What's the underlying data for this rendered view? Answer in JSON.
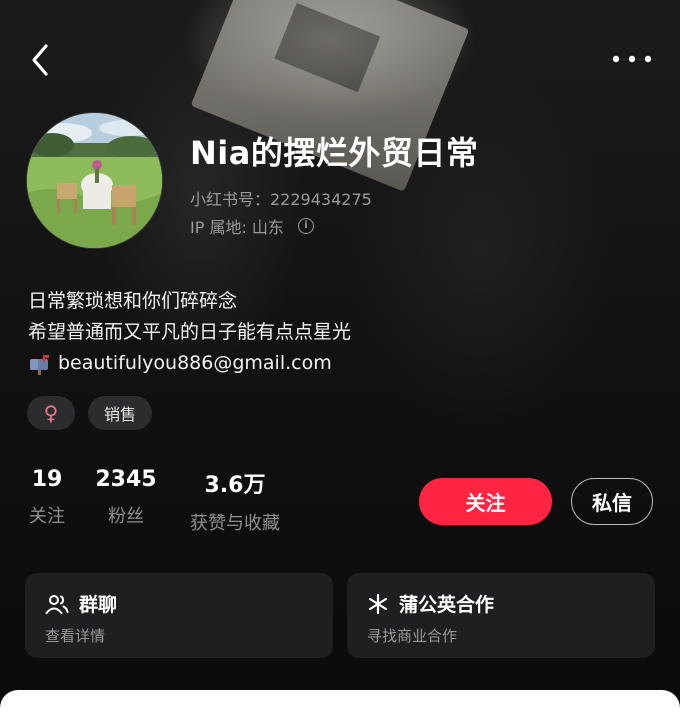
{
  "header": {
    "back_icon": "chevron-left-icon",
    "more_icon": "more-dots-icon"
  },
  "profile": {
    "nickname": "Nia的摆烂外贸日常",
    "id_line": "小红书号：2229434275",
    "ip_line": "IP 属地: 山东",
    "info_icon": "info-icon",
    "bio": [
      "日常繁琐想和你们碎碎念",
      "希望普通而又平凡的日子能有点点星光"
    ],
    "email": "beautifulyou886@gmail.com",
    "email_icon": "mailbox-icon",
    "tags": {
      "gender": "♀",
      "job": "销售"
    }
  },
  "stats": [
    {
      "value": "19",
      "label": "关注"
    },
    {
      "value": "2345",
      "label": "粉丝"
    },
    {
      "value": "3.6万",
      "label": "获赞与收藏"
    }
  ],
  "actions": {
    "follow": "关注",
    "message": "私信"
  },
  "cards": [
    {
      "title": "群聊",
      "subtitle": "查看详情",
      "icon": "group-icon"
    },
    {
      "title": "蒲公英合作",
      "subtitle": "寻找商业合作",
      "icon": "dandelion-icon"
    }
  ],
  "colors": {
    "accent": "#ff2442",
    "background": "#0c0c0d",
    "card": "#1f1f21",
    "gender": "#f0748e"
  }
}
